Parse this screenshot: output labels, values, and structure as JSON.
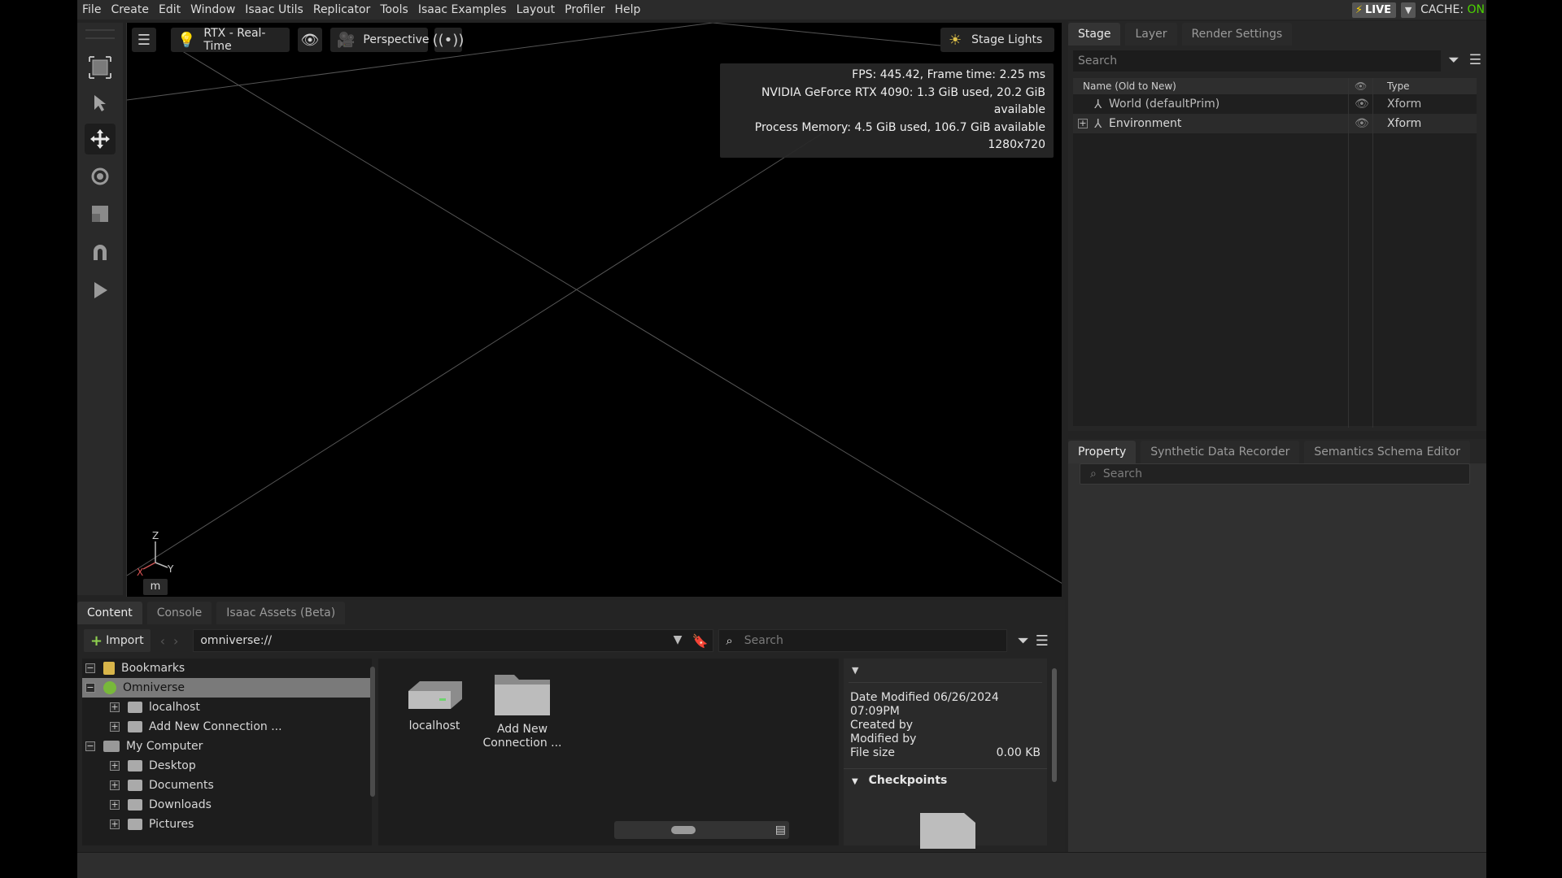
{
  "menu": [
    "File",
    "Create",
    "Edit",
    "Window",
    "Isaac Utils",
    "Replicator",
    "Tools",
    "Isaac Examples",
    "Layout",
    "Profiler",
    "Help"
  ],
  "status": {
    "live": "LIVE",
    "cache_label": "CACHE:",
    "cache_state": "ON"
  },
  "viewport": {
    "renderer": "RTX - Real-Time",
    "camera": "Perspective",
    "lights": "Stage Lights",
    "stats": [
      "FPS: 445.42, Frame time: 2.25 ms",
      "NVIDIA GeForce RTX 4090: 1.3 GiB used, 20.2 GiB available",
      "Process Memory: 4.5 GiB used, 106.7 GiB available",
      "1280x720"
    ],
    "axis_z": "Z",
    "axis_x": "X",
    "axis_y": "Y",
    "unit": "m"
  },
  "bottom": {
    "tabs": [
      "Content",
      "Console",
      "Isaac Assets (Beta)"
    ],
    "import_label": "Import",
    "path": "omniverse://",
    "search_placeholder": "Search",
    "tree": [
      {
        "label": "Bookmarks",
        "level": 0,
        "exp": "−"
      },
      {
        "label": "Omniverse",
        "level": 0,
        "exp": "−"
      },
      {
        "label": "localhost",
        "level": 1,
        "exp": "+"
      },
      {
        "label": "Add New Connection ...",
        "level": 1,
        "exp": "+"
      },
      {
        "label": "My Computer",
        "level": 0,
        "exp": "−"
      },
      {
        "label": "Desktop",
        "level": 1,
        "exp": "+"
      },
      {
        "label": "Documents",
        "level": 1,
        "exp": "+"
      },
      {
        "label": "Downloads",
        "level": 1,
        "exp": "+"
      },
      {
        "label": "Pictures",
        "level": 1,
        "exp": "+"
      }
    ],
    "grid_items": [
      "localhost",
      "Add New Connection ..."
    ],
    "details": {
      "date_modified": "Date Modified 06/26/2024 07:09PM",
      "created_by": "Created by",
      "modified_by": "Modified by",
      "file_size_label": "File size",
      "file_size_value": "0.00 KB",
      "checkpoints": "Checkpoints"
    }
  },
  "stage": {
    "tabs": [
      "Stage",
      "Layer",
      "Render Settings"
    ],
    "search_placeholder": "Search",
    "col_name": "Name (Old to New)",
    "col_type": "Type",
    "rows": [
      {
        "name": "World (defaultPrim)",
        "type": "Xform"
      },
      {
        "name": "Environment",
        "type": "Xform"
      }
    ]
  },
  "property": {
    "tabs": [
      "Property",
      "Synthetic Data Recorder",
      "Semantics Schema Editor"
    ],
    "search_placeholder": "Search"
  }
}
